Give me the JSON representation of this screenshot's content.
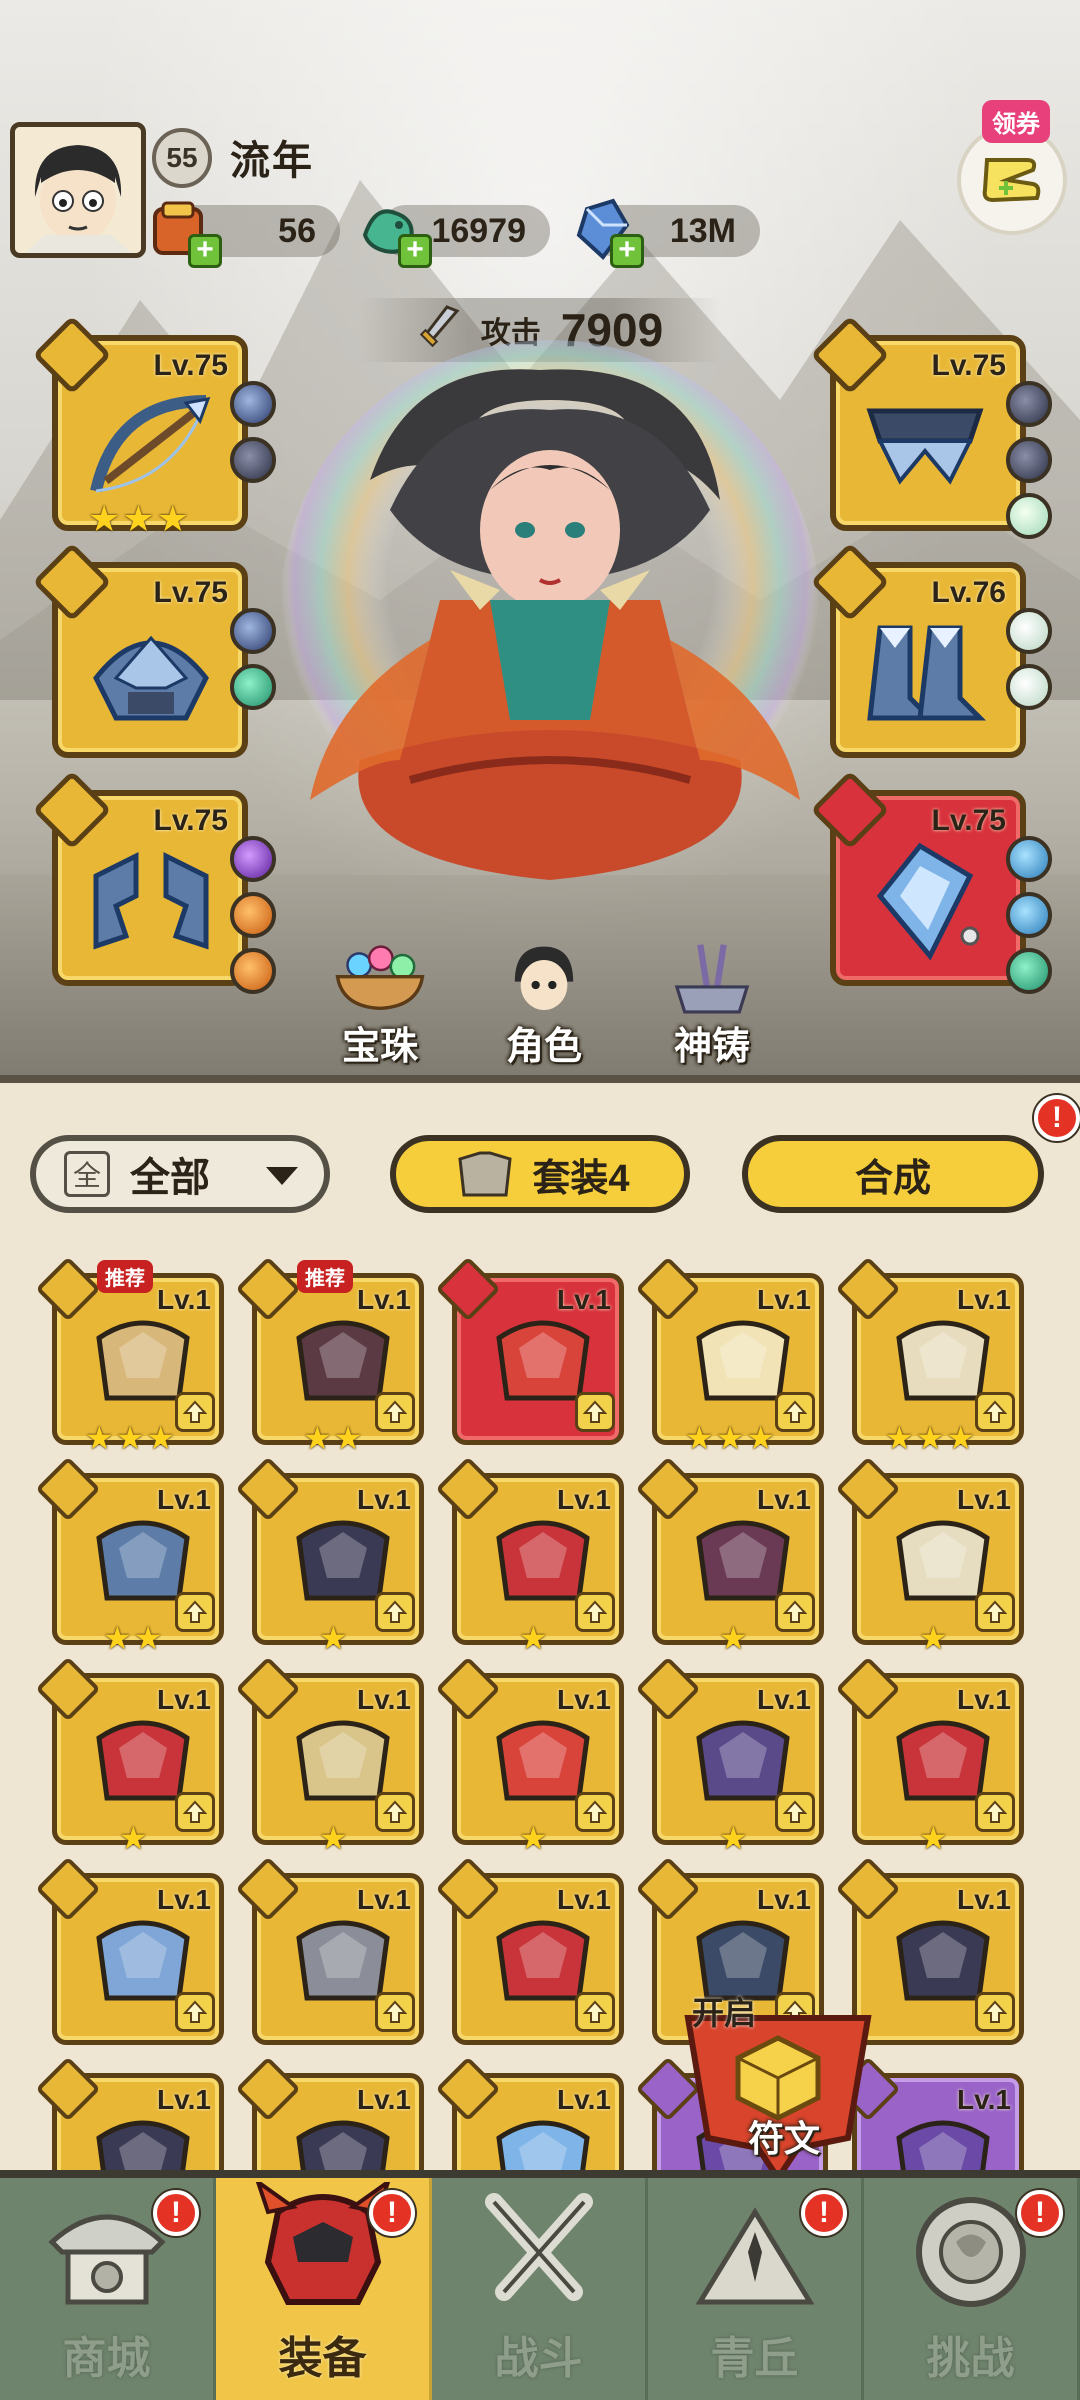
{
  "player": {
    "name": "流年",
    "level": "55",
    "avatar_icon": "player-portrait"
  },
  "resources": [
    {
      "name": "scroll",
      "icon": "scroll-bag-icon",
      "value": "56"
    },
    {
      "name": "jade",
      "icon": "jade-dragon-icon",
      "value": "16979"
    },
    {
      "name": "crystal",
      "icon": "blue-crystal-icon",
      "value": "13M"
    }
  ],
  "coupon": {
    "tag": "领券"
  },
  "attack": {
    "label": "攻击",
    "value": "7909"
  },
  "equipped": {
    "left": [
      {
        "slot": "weapon",
        "level": "Lv.75",
        "stars": 3,
        "icon": "crossbow-icon"
      },
      {
        "slot": "helmet",
        "level": "Lv.75",
        "stars": 0,
        "icon": "helmet-icon"
      },
      {
        "slot": "belt",
        "level": "Lv.75",
        "stars": 0,
        "icon": "belt-icon"
      }
    ],
    "right": [
      {
        "slot": "pants",
        "level": "Lv.75",
        "stars": 0,
        "icon": "waist-armor-icon"
      },
      {
        "slot": "boots",
        "level": "Lv.76",
        "stars": 0,
        "icon": "boots-icon"
      },
      {
        "slot": "amulet",
        "level": "Lv.75",
        "stars": 0,
        "icon": "pendant-icon",
        "rarity": "red"
      }
    ]
  },
  "quick_actions": [
    {
      "label": "宝珠",
      "icon": "orb-bowl-icon"
    },
    {
      "label": "角色",
      "icon": "character-icon"
    },
    {
      "label": "神铸",
      "icon": "divine-forge-icon"
    }
  ],
  "inventory": {
    "filter": {
      "box_label": "全",
      "label": "全部"
    },
    "set_button": {
      "label": "套装4"
    },
    "compose_button": {
      "label": "合成"
    },
    "recommend_tag": "推荐",
    "items": [
      {
        "level": "Lv.1",
        "stars": 3,
        "rarity": "gold",
        "icon": "armor-icon",
        "recommended": true
      },
      {
        "level": "Lv.1",
        "stars": 2,
        "rarity": "gold",
        "icon": "boots-icon",
        "recommended": true
      },
      {
        "level": "Lv.1",
        "stars": 0,
        "rarity": "red",
        "icon": "lotus-orb-icon"
      },
      {
        "level": "Lv.1",
        "stars": 3,
        "rarity": "gold",
        "icon": "horn-staff-icon"
      },
      {
        "level": "Lv.1",
        "stars": 3,
        "rarity": "gold",
        "icon": "claw-icon"
      },
      {
        "level": "Lv.1",
        "stars": 2,
        "rarity": "gold",
        "icon": "belt-icon"
      },
      {
        "level": "Lv.1",
        "stars": 1,
        "rarity": "gold",
        "icon": "helmet-icon"
      },
      {
        "level": "Lv.1",
        "stars": 1,
        "rarity": "gold",
        "icon": "thorn-ring-icon"
      },
      {
        "level": "Lv.1",
        "stars": 1,
        "rarity": "gold",
        "icon": "thorn-belt-icon"
      },
      {
        "level": "Lv.1",
        "stars": 1,
        "rarity": "gold",
        "icon": "feather-armor-icon"
      },
      {
        "level": "Lv.1",
        "stars": 1,
        "rarity": "gold",
        "icon": "lotus-waist-icon"
      },
      {
        "level": "Lv.1",
        "stars": 1,
        "rarity": "gold",
        "icon": "gold-boots-icon"
      },
      {
        "level": "Lv.1",
        "stars": 1,
        "rarity": "gold",
        "icon": "flame-orb-icon"
      },
      {
        "level": "Lv.1",
        "stars": 1,
        "rarity": "gold",
        "icon": "purple-orb-icon"
      },
      {
        "level": "Lv.1",
        "stars": 1,
        "rarity": "gold",
        "icon": "flower-staff-icon"
      },
      {
        "level": "Lv.1",
        "stars": 0,
        "rarity": "gold",
        "icon": "crossbow-icon"
      },
      {
        "level": "Lv.1",
        "stars": 0,
        "rarity": "gold",
        "icon": "forge-block-icon"
      },
      {
        "level": "Lv.1",
        "stars": 0,
        "rarity": "gold",
        "icon": "red-mask-icon"
      },
      {
        "level": "Lv.1",
        "stars": 0,
        "rarity": "gold",
        "icon": "waist-armor-icon"
      },
      {
        "level": "Lv.1",
        "stars": 0,
        "rarity": "gold",
        "icon": "dark-waist-icon"
      },
      {
        "level": "Lv.1",
        "stars": 0,
        "rarity": "gold",
        "icon": "dark-waist-icon"
      },
      {
        "level": "Lv.1",
        "stars": 0,
        "rarity": "gold",
        "icon": "dark-boots-icon"
      },
      {
        "level": "Lv.1",
        "stars": 0,
        "rarity": "gold",
        "icon": "pendant-icon"
      },
      {
        "level": "",
        "stars": 0,
        "rarity": "purple",
        "icon": "purple-item-icon"
      },
      {
        "level": "Lv.1",
        "stars": 0,
        "rarity": "purple",
        "icon": "purple-item-icon"
      }
    ]
  },
  "rune": {
    "open_label": "开启",
    "label": "符文"
  },
  "nav": [
    {
      "label": "商城",
      "icon": "shop-icon",
      "alert": "!",
      "active": false
    },
    {
      "label": "装备",
      "icon": "equipment-icon",
      "alert": "!",
      "active": true
    },
    {
      "label": "战斗",
      "icon": "crossed-swords-icon",
      "alert": "",
      "active": false
    },
    {
      "label": "青丘",
      "icon": "mountain-icon",
      "alert": "!",
      "active": false
    },
    {
      "label": "挑战",
      "icon": "challenge-icon",
      "alert": "!",
      "active": false
    }
  ],
  "alerts": {
    "panel": "!"
  },
  "colors": {
    "gold_card": "#e8b736",
    "red_card": "#d8333d",
    "purple_card": "#9a63c8",
    "nav_bg": "#6f846c",
    "nav_active": "#f0c548",
    "alert": "#e43324"
  }
}
